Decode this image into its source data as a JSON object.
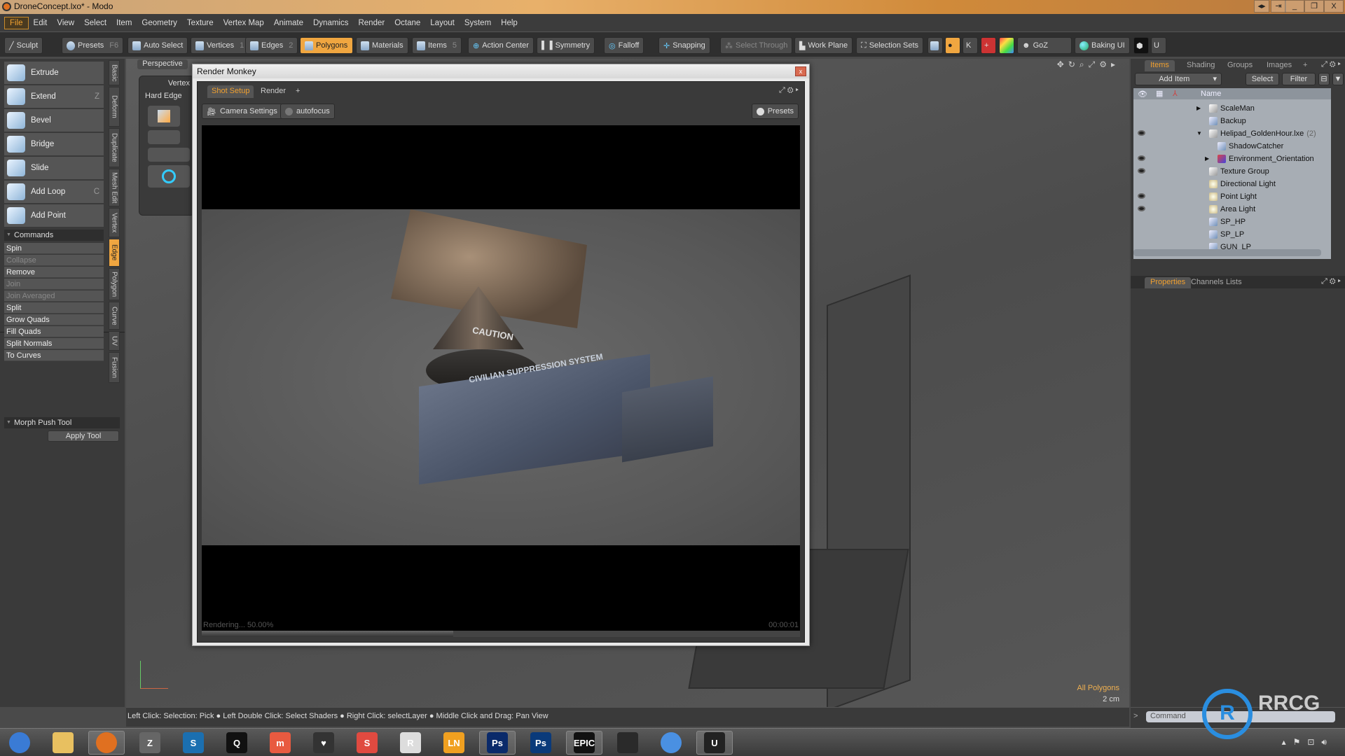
{
  "window": {
    "title": "DroneConcept.lxo* - Modo"
  },
  "menu": [
    "File",
    "Edit",
    "View",
    "Select",
    "Item",
    "Geometry",
    "Texture",
    "Vertex Map",
    "Animate",
    "Dynamics",
    "Render",
    "Octane",
    "Layout",
    "System",
    "Help"
  ],
  "toolbar": {
    "sculpt": "Sculpt",
    "presets": "Presets",
    "presets_key": "F6",
    "auto_select": "Auto Select",
    "vertices": "Vertices",
    "vertices_key": "1",
    "edges": "Edges",
    "edges_key": "2",
    "polygons": "Polygons",
    "materials": "Materials",
    "items": "Items",
    "items_key": "5",
    "action_center": "Action Center",
    "symmetry": "Symmetry",
    "falloff": "Falloff",
    "snapping": "Snapping",
    "select_through": "Select Through",
    "work_plane": "Work Plane",
    "selection_sets": "Selection Sets",
    "goz": "GoZ",
    "baking_ui": "Baking UI"
  },
  "left_panel": {
    "tools": [
      {
        "label": "Extrude",
        "key": ""
      },
      {
        "label": "Extend",
        "key": "Z"
      },
      {
        "label": "Bevel",
        "key": ""
      },
      {
        "label": "Bridge",
        "key": ""
      },
      {
        "label": "Slide",
        "key": ""
      },
      {
        "label": "Add Loop",
        "key": "C"
      },
      {
        "label": "Add Point",
        "key": ""
      }
    ],
    "commands_title": "Commands",
    "commands": [
      {
        "label": "Spin",
        "enabled": true
      },
      {
        "label": "Collapse",
        "enabled": false
      },
      {
        "label": "Remove",
        "enabled": true
      },
      {
        "label": "Join",
        "enabled": false
      },
      {
        "label": "Join Averaged",
        "enabled": false
      },
      {
        "label": "Split",
        "enabled": true
      },
      {
        "label": "Grow Quads",
        "enabled": true
      },
      {
        "label": "Fill Quads",
        "enabled": true
      },
      {
        "label": "Split Normals",
        "enabled": true
      },
      {
        "label": "To Curves",
        "enabled": true
      }
    ],
    "vertical_tabs": [
      "Basic",
      "Deform",
      "Duplicate",
      "Mesh Edit",
      "Vertex",
      "Edge",
      "Polygon",
      "Curve",
      "UV",
      "Fusion"
    ],
    "active_tab": "Edge",
    "morph_title": "Morph Push Tool",
    "apply_tool": "Apply Tool"
  },
  "viewport": {
    "label": "Perspective",
    "sub_label": "Vertex",
    "hard_edge": "Hard Edge",
    "selection_info": "All Polygons",
    "grid_size": "2 cm"
  },
  "render_monkey": {
    "title": "Render Monkey",
    "close": "x",
    "tabs": [
      "Shot Setup",
      "Render"
    ],
    "add_tab": "+",
    "camera_settings": "Camera Settings",
    "autofocus": "autofocus",
    "presets": "Presets",
    "status": "Rendering... 50.00%",
    "time": "00:00:01",
    "progress": 50,
    "render_text": [
      "CAUTION",
      "CIVILIAN SUPPRESSION SYSTEM"
    ]
  },
  "right_panel": {
    "tabs": [
      "Items",
      "Shading",
      "Groups",
      "Images"
    ],
    "add_tab": "+",
    "add_item": "Add Item",
    "select": "Select",
    "filter": "Filter",
    "name_header": "Name",
    "items": [
      {
        "name": "ScaleMan",
        "depth": 0,
        "visible": false,
        "type": "group"
      },
      {
        "name": "Backup",
        "depth": 0,
        "visible": false,
        "type": "mesh"
      },
      {
        "name": "Helipad_GoldenHour.lxe",
        "count": "(2)",
        "depth": 0,
        "visible": true,
        "type": "group"
      },
      {
        "name": "ShadowCatcher",
        "depth": 1,
        "visible": false,
        "type": "mesh"
      },
      {
        "name": "Environment_Orientation",
        "depth": 1,
        "visible": true,
        "type": "locator"
      },
      {
        "name": "Texture Group",
        "depth": 0,
        "visible": true,
        "type": "group"
      },
      {
        "name": "Directional Light",
        "depth": 0,
        "visible": false,
        "type": "light"
      },
      {
        "name": "Point Light",
        "depth": 0,
        "visible": true,
        "type": "light"
      },
      {
        "name": "Area Light",
        "depth": 0,
        "visible": true,
        "type": "light"
      },
      {
        "name": "SP_HP",
        "depth": 0,
        "visible": false,
        "type": "mesh"
      },
      {
        "name": "SP_LP",
        "depth": 0,
        "visible": false,
        "type": "mesh"
      },
      {
        "name": "GUN_LP",
        "depth": 0,
        "visible": false,
        "type": "mesh"
      }
    ],
    "bottom_tabs": [
      "Properties",
      "Channels",
      "Lists"
    ],
    "command_prompt": ">",
    "command_placeholder": "Command"
  },
  "status_bar": "Left Click: Selection: Pick ● Left Double Click: Select Shaders ● Right Click: selectLayer ● Middle Click and Drag: Pan View",
  "taskbar": [
    {
      "name": "start",
      "label": "",
      "color": "#3a7bd5"
    },
    {
      "name": "file-explorer",
      "label": "",
      "color": "#e8c060"
    },
    {
      "name": "blender",
      "label": "",
      "color": "#e07020"
    },
    {
      "name": "zbrush",
      "label": "Z",
      "color": "#666"
    },
    {
      "name": "steam",
      "label": "S",
      "color": "#1b6fb0"
    },
    {
      "name": "quixel",
      "label": "Q",
      "color": "#111"
    },
    {
      "name": "marmoset",
      "label": "m",
      "color": "#e85a40"
    },
    {
      "name": "app-red",
      "label": "♥",
      "color": "#333"
    },
    {
      "name": "substance",
      "label": "S",
      "color": "#e04a40"
    },
    {
      "name": "reality-capture",
      "label": "R",
      "color": "#ddd"
    },
    {
      "name": "ln",
      "label": "LN",
      "color": "#f0a020"
    },
    {
      "name": "photoshop",
      "label": "Ps",
      "color": "#0a2a6a"
    },
    {
      "name": "photoshop-2",
      "label": "Ps",
      "color": "#0a3a7a"
    },
    {
      "name": "epic-games",
      "label": "EPIC",
      "color": "#111"
    },
    {
      "name": "intellij",
      "label": "",
      "color": "#2a2a2a"
    },
    {
      "name": "chrome",
      "label": "",
      "color": "#4a90e2"
    },
    {
      "name": "unreal",
      "label": "U",
      "color": "#222"
    }
  ],
  "watermark": "RRCG 人人素材"
}
